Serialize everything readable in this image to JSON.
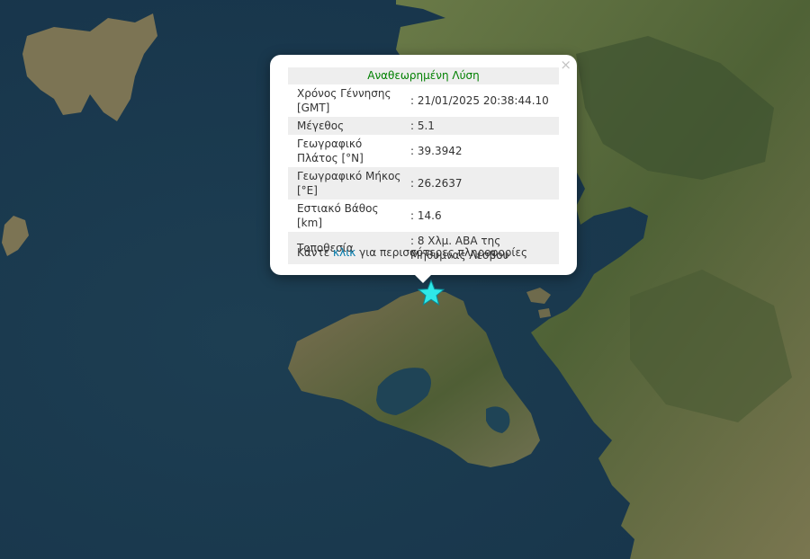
{
  "popup": {
    "title": "Αναθεωρημένη Λύση",
    "close_glyph": "×",
    "rows": [
      {
        "label": "Χρόνος Γέννησης [GMT]",
        "value": ": 21/01/2025 20:38:44.10"
      },
      {
        "label": "Μέγεθος",
        "value": ": 5.1"
      },
      {
        "label": "Γεωγραφικό Πλάτος [°N]",
        "value": ": 39.3942"
      },
      {
        "label": "Γεωγραφικό Μήκος [°E]",
        "value": ": 26.2637"
      },
      {
        "label": "Εστιακό Βάθος [km]",
        "value": ": 14.6"
      },
      {
        "label": "Τοποθεσία",
        "value": ": 8 Χλμ. ΑΒΑ της Μήθυμνας Λέσβου"
      }
    ],
    "more_prefix": "Κάντε ",
    "more_link": "κλικ",
    "more_suffix": " για περισσότερες πληροφορίες"
  },
  "marker": {
    "icon": "star-icon",
    "color": "#2ee8e8"
  },
  "colors": {
    "sea": "#1c3d4f",
    "land": "#5b6b3e",
    "title_green": "#008000",
    "link": "#0078a8"
  }
}
